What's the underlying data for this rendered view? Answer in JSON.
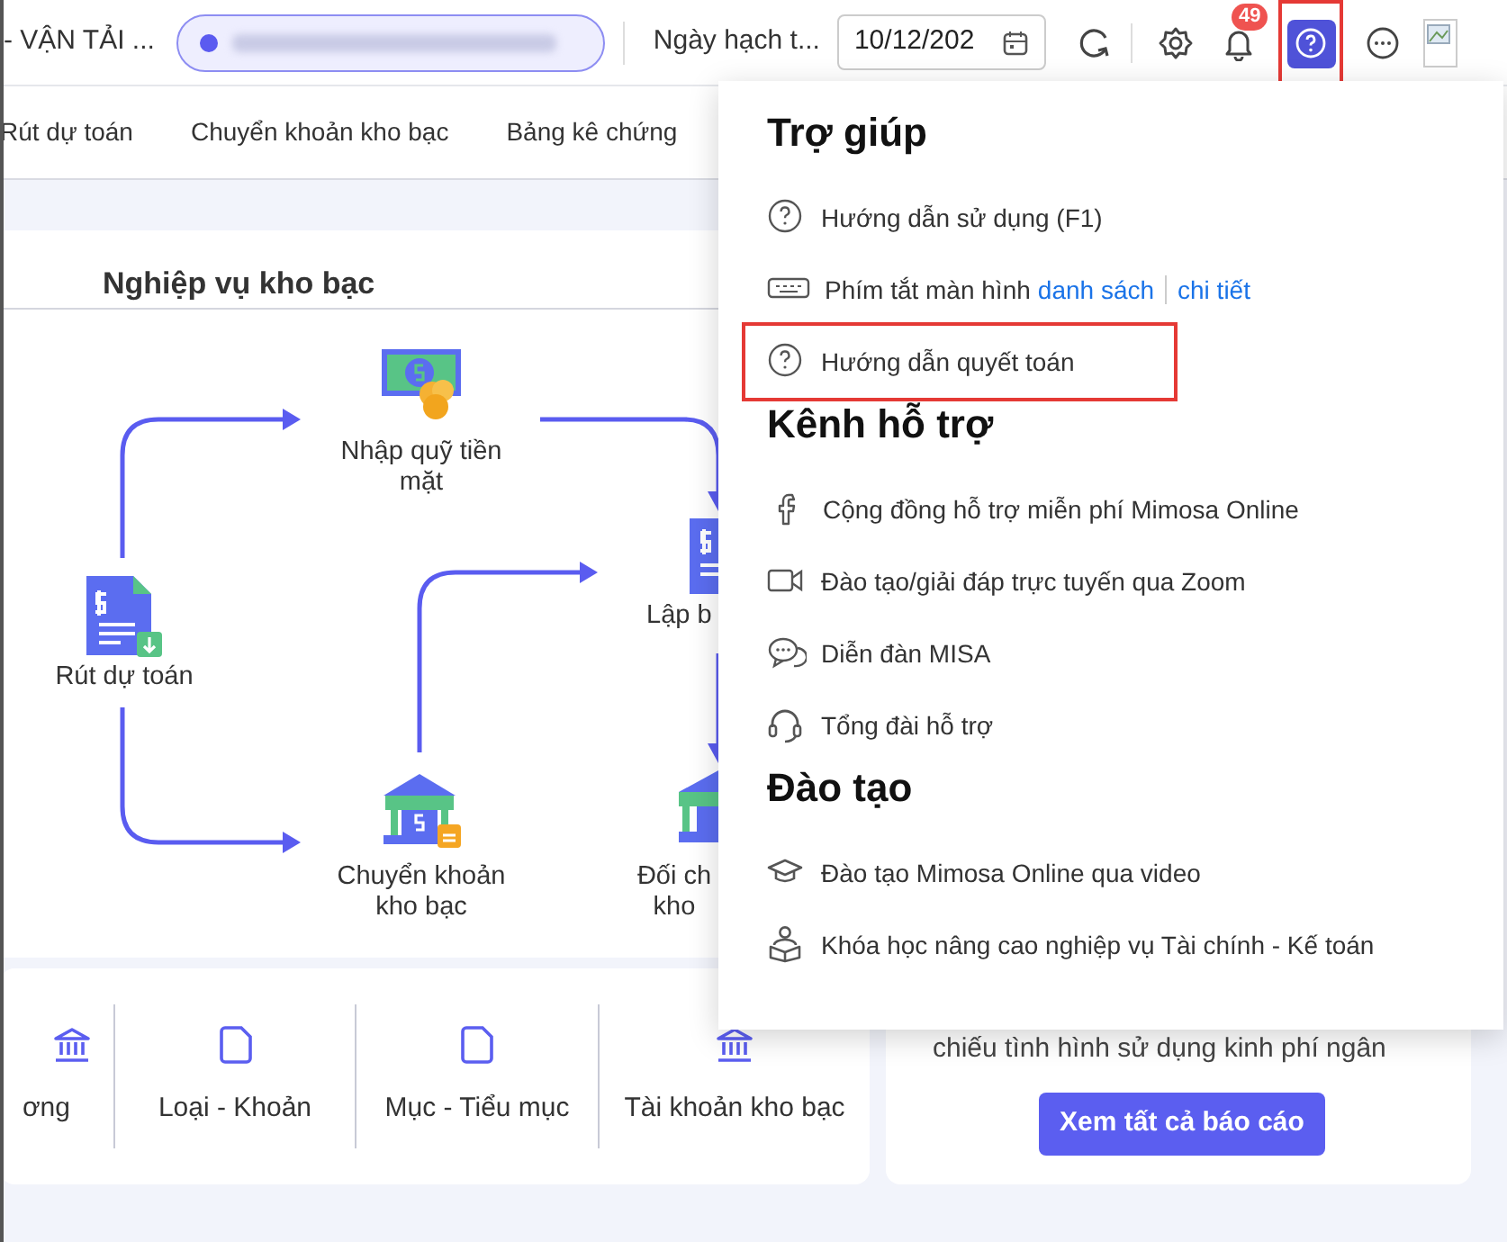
{
  "top_bar": {
    "unit_name": "- VẬN TẢI ...",
    "date_label": "Ngày hạch t...",
    "date_value": "10/12/202",
    "notification_count": "49",
    "help_selected": true
  },
  "tabs": [
    {
      "label": "Rút dự toán"
    },
    {
      "label": "Chuyển khoản kho bạc"
    },
    {
      "label": "Bảng kê chứng"
    }
  ],
  "section_title": "Nghiệp vụ kho bạc",
  "diagram_nodes": [
    {
      "kind": "withdraw",
      "label": "Rút dự toán"
    },
    {
      "kind": "cash",
      "label": "Nhập quỹ tiền mặt"
    },
    {
      "kind": "bank-transfer",
      "label": "Chuyển khoản kho bạc"
    },
    {
      "kind": "document",
      "label": "Lập b"
    },
    {
      "kind": "bank",
      "label": "Đối ch\nkho"
    }
  ],
  "catalog_links": [
    {
      "kind": "bank",
      "label": "ơng"
    },
    {
      "kind": "folder",
      "label": "Loại - Khoản"
    },
    {
      "kind": "folder",
      "label": "Mục - Tiểu mục"
    },
    {
      "kind": "bank",
      "label": "Tài khoản kho bạc"
    }
  ],
  "report_card": {
    "text": "chiếu tình hình sử dụng kinh phí ngân",
    "button": "Xem tất cả báo cáo"
  },
  "help_menu": [
    {
      "title": "Trợ giúp",
      "items": [
        {
          "kind": "question",
          "label": "Hướng dẫn sử dụng (F1)",
          "highlighted": false
        },
        {
          "kind": "keyboard",
          "label": "Phím tắt màn hình",
          "links": [
            "danh sách",
            "chi tiết"
          ],
          "highlighted": false
        },
        {
          "kind": "question",
          "label": "Hướng dẫn quyết toán",
          "highlighted": true
        }
      ]
    },
    {
      "title": "Kênh hỗ trợ",
      "items": [
        {
          "kind": "facebook",
          "label": "Cộng đồng hỗ trợ miễn phí Mimosa Online",
          "highlighted": false
        },
        {
          "kind": "video",
          "label": "Đào tạo/giải đáp trực tuyến qua Zoom",
          "highlighted": false
        },
        {
          "kind": "chat",
          "label": "Diễn đàn MISA",
          "highlighted": false
        },
        {
          "kind": "headset",
          "label": "Tổng đài hỗ trợ",
          "highlighted": false
        }
      ]
    },
    {
      "title": "Đào tạo",
      "items": [
        {
          "kind": "cap",
          "label": "Đào tạo Mimosa Online qua video",
          "highlighted": false
        },
        {
          "kind": "reader",
          "label": "Khóa học nâng cao nghiệp vụ Tài chính - Kế toán",
          "highlighted": false
        }
      ]
    }
  ]
}
